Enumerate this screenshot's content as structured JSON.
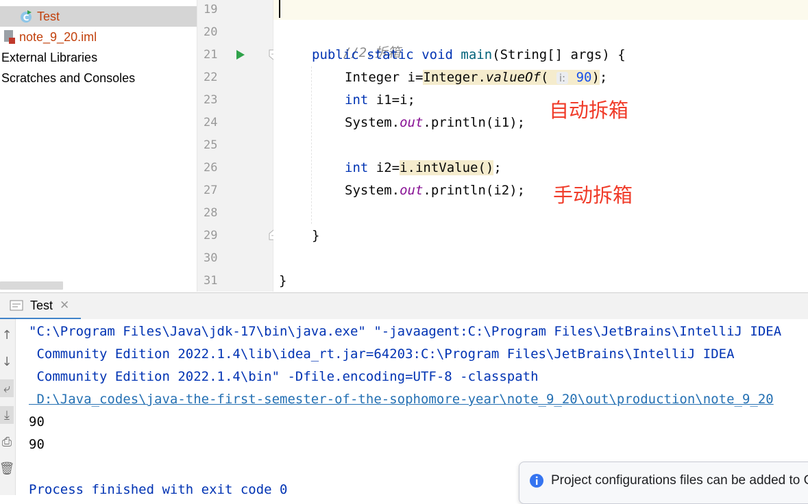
{
  "project_tree": {
    "items": [
      {
        "label": "Test",
        "icon": "java-class-icon"
      },
      {
        "label": "note_9_20.iml",
        "icon": "iml-file-icon"
      },
      {
        "label": "External Libraries",
        "icon": ""
      },
      {
        "label": "Scratches and Consoles",
        "icon": ""
      }
    ]
  },
  "editor": {
    "line_numbers": [
      "19",
      "20",
      "21",
      "22",
      "23",
      "24",
      "25",
      "26",
      "27",
      "28",
      "29",
      "30",
      "31"
    ],
    "comment": "//2.拆箱",
    "line21": {
      "kw1": "public",
      "kw2": "static",
      "kw3": "void",
      "fn": "main",
      "rest": "(String[] args) {"
    },
    "line22": {
      "pre": "Integer i=",
      "cls": "Integer.",
      "method": "valueOf",
      "open": "(",
      "hint": "i:",
      "value": "90",
      "close": ")",
      "end": ";"
    },
    "line23": {
      "kw": "int",
      "rest": " i1=i;"
    },
    "line24": {
      "pre": "System.",
      "field": "out",
      "rest": ".println(i1);"
    },
    "line26": {
      "kw": "int",
      "pre": " i2=",
      "hl": "i.intValue()",
      "end": ";"
    },
    "line27": {
      "pre": "System.",
      "field": "out",
      "rest": ".println(i2);"
    },
    "line29": "}",
    "line31": "}",
    "annotations": {
      "auto_unboxing": "自动拆箱",
      "manual_unboxing": "手动拆箱"
    }
  },
  "run_window": {
    "tab_label": "Test",
    "console_lines": [
      "\"C:\\Program Files\\Java\\jdk-17\\bin\\java.exe\" \"-javaagent:C:\\Program Files\\JetBrains\\IntelliJ IDEA",
      " Community Edition 2022.1.4\\lib\\idea_rt.jar=64203:C:\\Program Files\\JetBrains\\IntelliJ IDEA",
      " Community Edition 2022.1.4\\bin\" -Dfile.encoding=UTF-8 -classpath",
      " D:\\Java_codes\\java-the-first-semester-of-the-sophomore-year\\note_9_20\\out\\production\\note_9_20",
      "90",
      "90",
      "",
      "Process finished with exit code 0"
    ]
  },
  "notification": {
    "text": "Project configurations files can be added to Git"
  },
  "colors": {
    "keyword": "#0033b3",
    "annotation_red": "#f03c2a",
    "run_tab_underline": "#4083c9",
    "run_icon": "#2fa24a"
  }
}
